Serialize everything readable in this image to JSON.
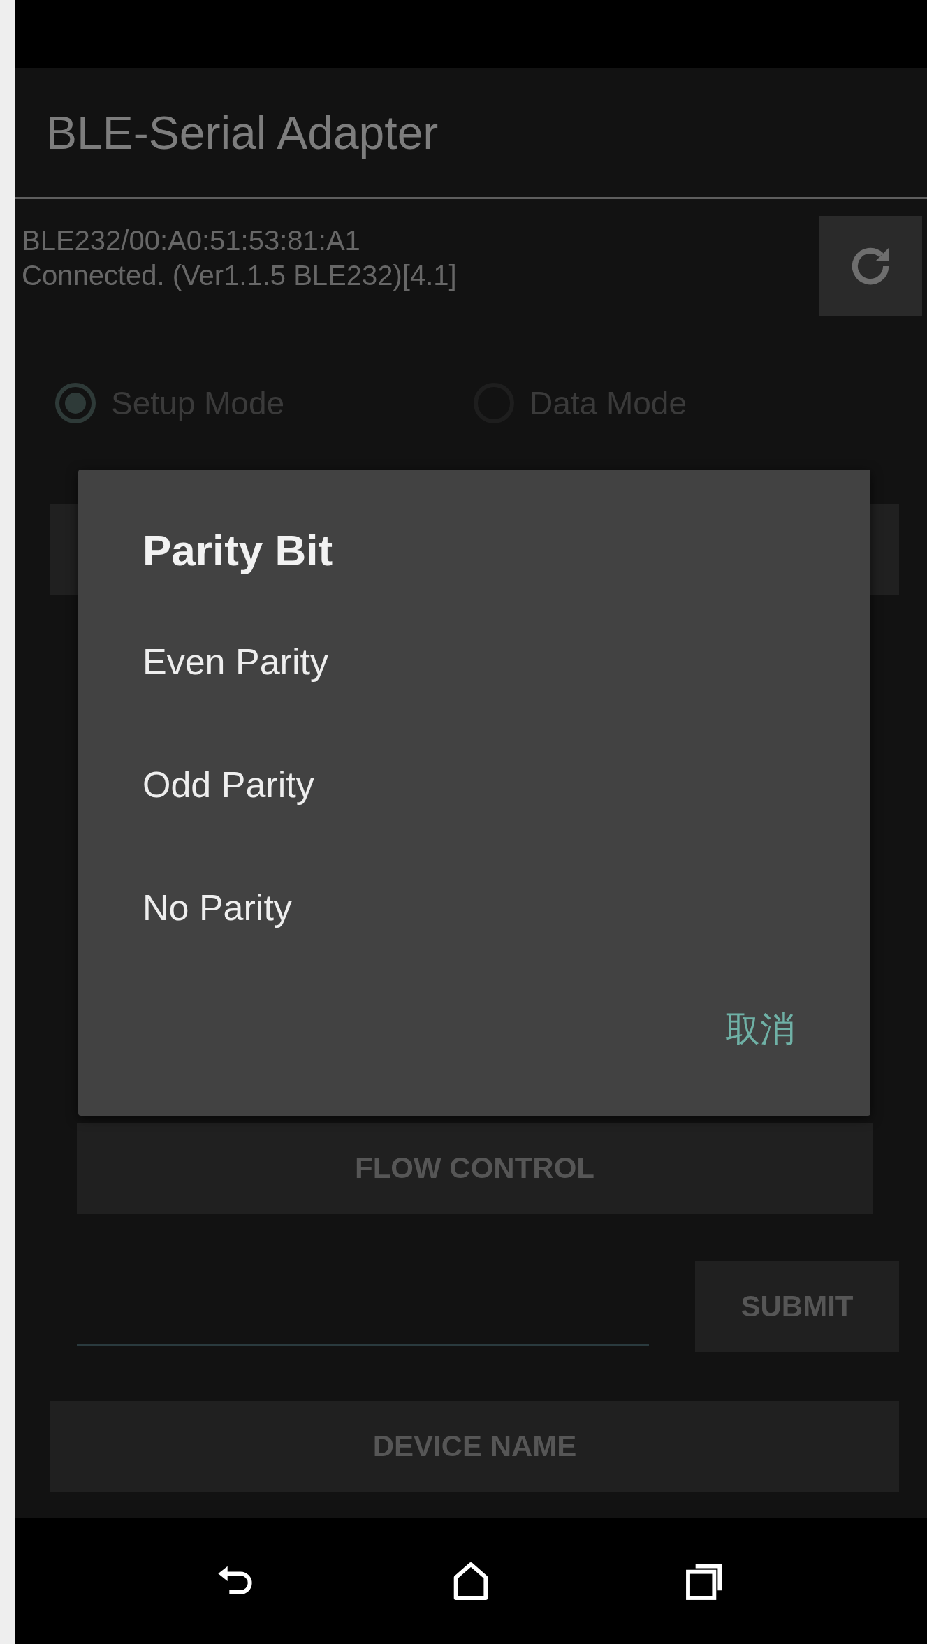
{
  "app_bar": {
    "title": "BLE-Serial Adapter"
  },
  "device": {
    "address": "BLE232/00:A0:51:53:81:A1",
    "status": "Connected. (Ver1.1.5 BLE232)[4.1]"
  },
  "modes": [
    {
      "label": "Setup Mode",
      "selected": true
    },
    {
      "label": "Data Mode",
      "selected": false
    }
  ],
  "buttons": {
    "flow_control": "FLOW CONTROL",
    "submit": "SUBMIT",
    "device_name": "DEVICE NAME"
  },
  "dialog": {
    "title": "Parity Bit",
    "options": [
      "Even Parity",
      "Odd Parity",
      "No Parity"
    ],
    "cancel": "取消"
  }
}
